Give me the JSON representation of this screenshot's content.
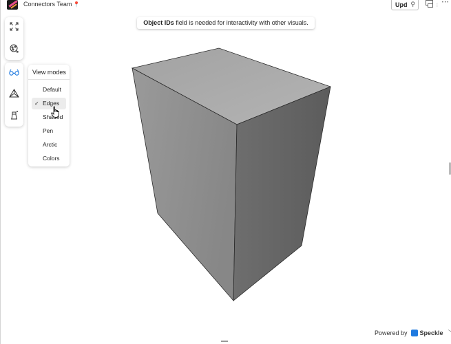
{
  "app": {
    "title": "Connectors Team"
  },
  "header": {
    "update_label": "Upd"
  },
  "notice": {
    "bold": "Object IDs",
    "rest": " field is needed for interactivity with other visuals."
  },
  "toolbar": {
    "group1": [
      {
        "name": "fullscreen-icon"
      },
      {
        "name": "model-filter-icon"
      }
    ],
    "group2": [
      {
        "name": "view-modes-icon"
      },
      {
        "name": "camera-views-icon"
      },
      {
        "name": "lighting-icon"
      }
    ]
  },
  "view_modes": {
    "header": "View modes",
    "items": [
      {
        "label": "Default",
        "selected": false
      },
      {
        "label": "Edges",
        "selected": true
      },
      {
        "label": "Shaded",
        "selected": false
      },
      {
        "label": "Pen",
        "selected": false
      },
      {
        "label": "Arctic",
        "selected": false
      },
      {
        "label": "Colors",
        "selected": false
      }
    ],
    "check_glyph": "✓"
  },
  "footer": {
    "powered_by": "Powered by",
    "brand": "Speckle"
  },
  "colors": {
    "accent": "#1f7ae0",
    "box_top": "#a9a9a9",
    "box_left": "#8f8f8f",
    "box_right": "#666666"
  }
}
